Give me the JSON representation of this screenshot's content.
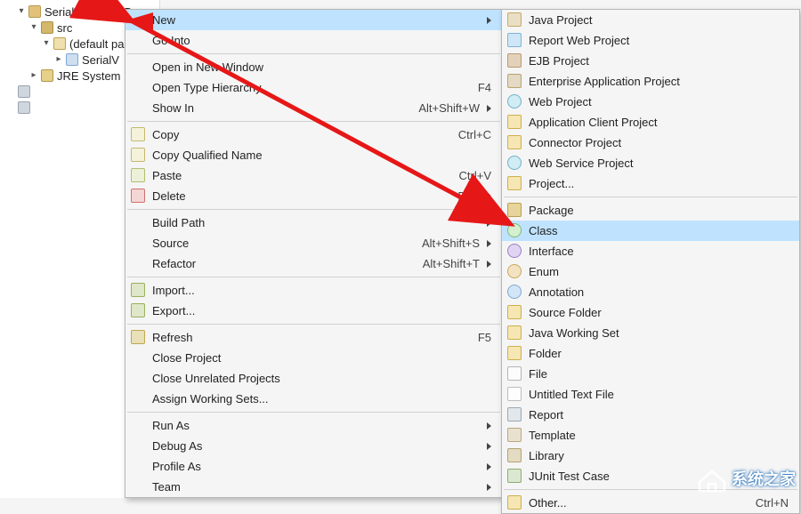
{
  "tree": {
    "project": "SerialVersionUID",
    "src": "src",
    "pkg": "(default pa",
    "cu": "SerialV",
    "jre": "JRE System Li",
    "task1": "",
    "task2": ""
  },
  "menu1": [
    {
      "label": "New",
      "accel": "",
      "sub": true,
      "icon": "none",
      "hover": true
    },
    {
      "label": "Go Into",
      "accel": "",
      "icon": "none"
    },
    {
      "sep": true
    },
    {
      "label": "Open in New Window",
      "accel": "",
      "icon": "none"
    },
    {
      "label": "Open Type Hierarchy",
      "accel": "F4",
      "icon": "none"
    },
    {
      "label": "Show In",
      "accel": "Alt+Shift+W",
      "sub": true,
      "icon": "none"
    },
    {
      "sep": true
    },
    {
      "label": "Copy",
      "accel": "Ctrl+C",
      "icon": "ic-copy"
    },
    {
      "label": "Copy Qualified Name",
      "accel": "",
      "icon": "ic-copy"
    },
    {
      "label": "Paste",
      "accel": "Ctrl+V",
      "icon": "ic-paste"
    },
    {
      "label": "Delete",
      "accel": "Delete",
      "icon": "ic-delete"
    },
    {
      "sep": true
    },
    {
      "label": "Build Path",
      "accel": "",
      "sub": true,
      "icon": "none"
    },
    {
      "label": "Source",
      "accel": "Alt+Shift+S",
      "sub": true,
      "icon": "none"
    },
    {
      "label": "Refactor",
      "accel": "Alt+Shift+T",
      "sub": true,
      "icon": "none"
    },
    {
      "sep": true
    },
    {
      "label": "Import...",
      "accel": "",
      "icon": "ic-import"
    },
    {
      "label": "Export...",
      "accel": "",
      "icon": "ic-export"
    },
    {
      "sep": true
    },
    {
      "label": "Refresh",
      "accel": "F5",
      "icon": "ic-refresh"
    },
    {
      "label": "Close Project",
      "accel": "",
      "icon": "none"
    },
    {
      "label": "Close Unrelated Projects",
      "accel": "",
      "icon": "none"
    },
    {
      "label": "Assign Working Sets...",
      "accel": "",
      "icon": "none"
    },
    {
      "sep": true
    },
    {
      "label": "Run As",
      "accel": "",
      "sub": true,
      "icon": "none"
    },
    {
      "label": "Debug As",
      "accel": "",
      "sub": true,
      "icon": "none"
    },
    {
      "label": "Profile As",
      "accel": "",
      "sub": true,
      "icon": "none"
    },
    {
      "label": "Team",
      "accel": "",
      "sub": true,
      "icon": "none"
    }
  ],
  "menu2": [
    {
      "label": "Java Project",
      "icon": "ic-java"
    },
    {
      "label": "Report Web Project",
      "icon": "ic-web"
    },
    {
      "label": "EJB Project",
      "icon": "ic-ejb"
    },
    {
      "label": "Enterprise Application Project",
      "icon": "ic-ear"
    },
    {
      "label": "Web Project",
      "icon": "ic-globe"
    },
    {
      "label": "Application Client Project",
      "icon": "ic-folder"
    },
    {
      "label": "Connector Project",
      "icon": "ic-folder"
    },
    {
      "label": "Web Service Project",
      "icon": "ic-globe"
    },
    {
      "label": "Project...",
      "icon": "ic-folder"
    },
    {
      "sep": true
    },
    {
      "label": "Package",
      "icon": "ic-pack"
    },
    {
      "label": "Class",
      "icon": "ic-class",
      "hover": true
    },
    {
      "label": "Interface",
      "icon": "ic-iface"
    },
    {
      "label": "Enum",
      "icon": "ic-enum"
    },
    {
      "label": "Annotation",
      "icon": "ic-ann"
    },
    {
      "label": "Source Folder",
      "icon": "ic-folder"
    },
    {
      "label": "Java Working Set",
      "icon": "ic-folder"
    },
    {
      "label": "Folder",
      "icon": "ic-folder"
    },
    {
      "label": "File",
      "icon": "ic-file"
    },
    {
      "label": "Untitled Text File",
      "icon": "ic-txt"
    },
    {
      "label": "Report",
      "icon": "ic-rpt"
    },
    {
      "label": "Template",
      "icon": "ic-tmpl"
    },
    {
      "label": "Library",
      "icon": "ic-lib"
    },
    {
      "label": "JUnit Test Case",
      "icon": "ic-junit"
    },
    {
      "sep": true
    },
    {
      "label": "Other...",
      "accel": "Ctrl+N",
      "icon": "ic-folder"
    }
  ],
  "watermark": "系统之家"
}
